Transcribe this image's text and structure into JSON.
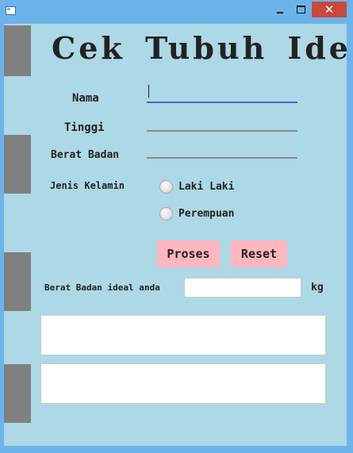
{
  "window": {
    "close_glyph": "✕"
  },
  "form": {
    "title": "Cek Tubuh Ideal",
    "nama_label": "Nama",
    "tinggi_label": "Tinggi",
    "berat_label": "Berat Badan",
    "jenis_kelamin_label": "Jenis Kelamin",
    "nama_value": "",
    "tinggi_value": "",
    "berat_value": "",
    "radio_laki": "Laki Laki",
    "radio_perempuan": "Perempuan",
    "proses_button": "Proses",
    "reset_button": "Reset",
    "result_label": "Berat Badan ideal anda",
    "result_unit": "kg",
    "result_value": ""
  },
  "colors": {
    "window_frame": "#6bb3ea",
    "panel_background": "#add8e6",
    "side_blocks": "#808080",
    "button_background": "#ffb6c1",
    "close_button": "#c74a3c"
  }
}
